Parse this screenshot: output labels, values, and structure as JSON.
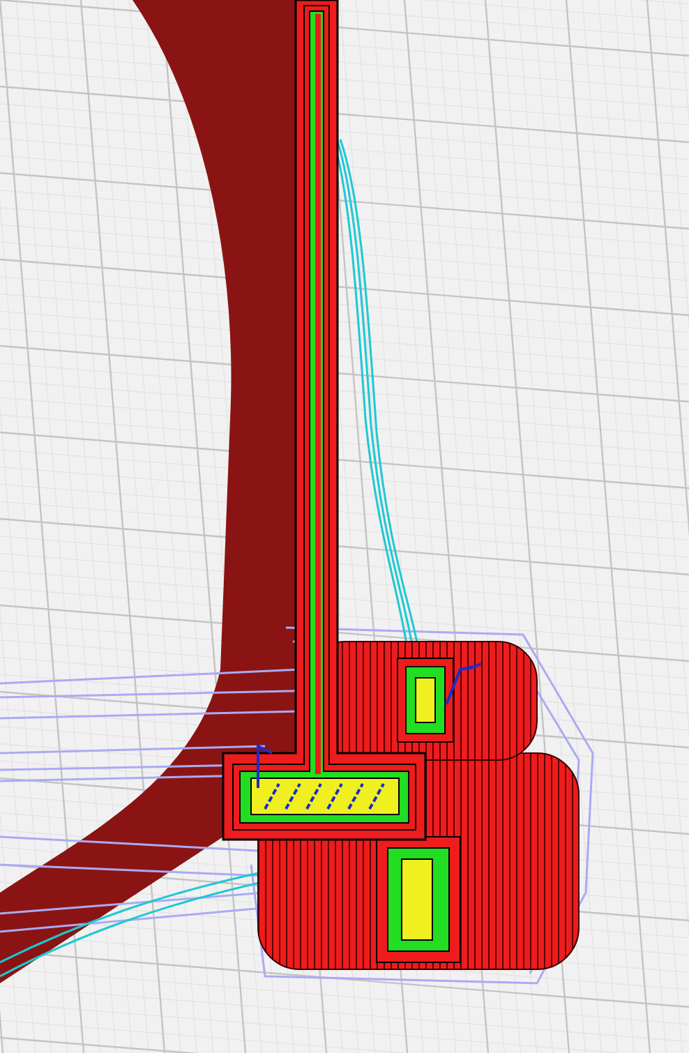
{
  "viewport": {
    "kind": "toolpath-preview"
  }
}
